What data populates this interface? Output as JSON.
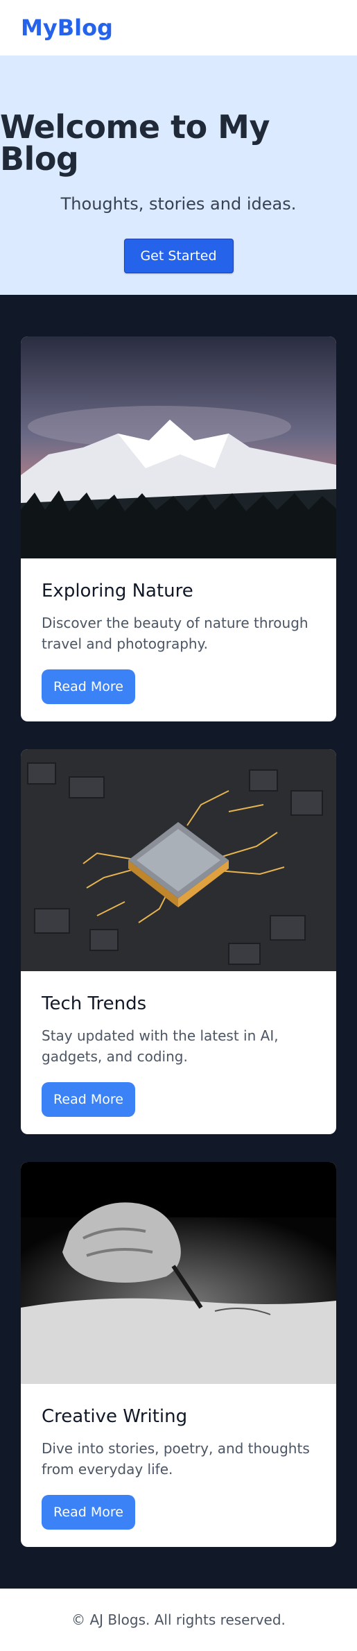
{
  "header": {
    "logo": "MyBlog"
  },
  "hero": {
    "title": "Welcome to My Blog",
    "subtitle": "Thoughts, stories and ideas.",
    "cta_label": "Get Started"
  },
  "cards": [
    {
      "title": "Exploring Nature",
      "description": "Discover the beauty of nature through travel and photography.",
      "button_label": "Read More",
      "image": "snowy-mountain-photo"
    },
    {
      "title": "Tech Trends",
      "description": "Stay updated with the latest in AI, gadgets, and coding.",
      "button_label": "Read More",
      "image": "circuit-chip-photo"
    },
    {
      "title": "Creative Writing",
      "description": "Dive into stories, poetry, and thoughts from everyday life.",
      "button_label": "Read More",
      "image": "hand-writing-photo"
    }
  ],
  "footer": {
    "text": "© AJ Blogs. All rights reserved."
  },
  "colors": {
    "brand": "#2563eb",
    "hero_bg": "#dbeafe",
    "page_bg": "#111827",
    "button": "#3b82f6"
  }
}
